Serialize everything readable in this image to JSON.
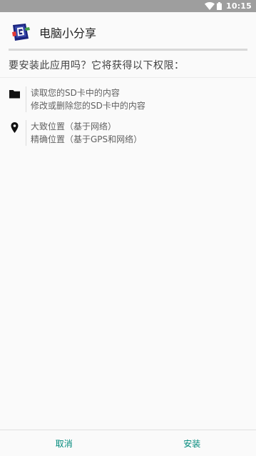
{
  "status_bar": {
    "time": "10:15",
    "icons": [
      "wifi-icon",
      "battery-icon"
    ]
  },
  "app": {
    "name": "电脑小分享",
    "icon": "app-logo-icon"
  },
  "prompt": "要安装此应用吗？它将获得以下权限：",
  "permissions": [
    {
      "icon": "folder-icon",
      "lines": [
        "读取您的SD卡中的内容",
        "修改或删除您的SD卡中的内容"
      ]
    },
    {
      "icon": "location-pin-icon",
      "lines": [
        "大致位置（基于网络）",
        "精确位置（基于GPS和网络）"
      ]
    }
  ],
  "buttons": {
    "cancel": "取消",
    "install": "安装"
  },
  "colors": {
    "status_bar": "#9e9e9e",
    "background": "#fafafa",
    "button_text": "#00897b"
  }
}
